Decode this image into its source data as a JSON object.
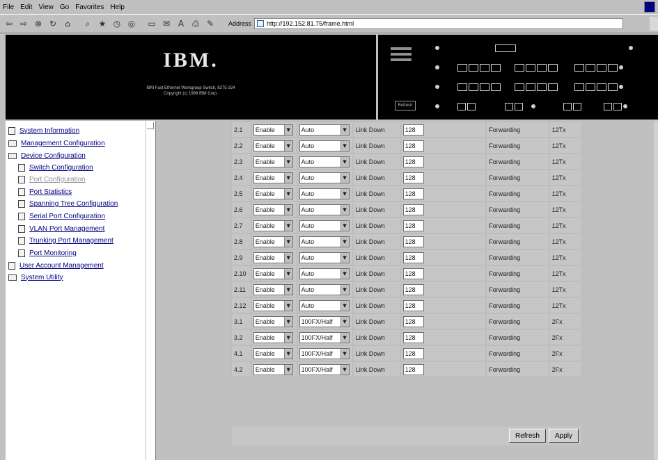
{
  "browser": {
    "menu": [
      "File",
      "Edit",
      "View",
      "Go",
      "Favorites",
      "Help"
    ],
    "address_label": "Address",
    "address_url": "http://192.152.81.75/frame.html"
  },
  "banner": {
    "logo": "IBM.",
    "line1": "IBM Fast Ethernet Workgroup Switch, 8275-324",
    "line2": "Copyright (c) 1998 IBM Corp.",
    "panel_refresh": "Refresh"
  },
  "tree": {
    "items": [
      {
        "label": "System Information",
        "icon": "page-icon"
      },
      {
        "label": "Management Configuration",
        "icon": "folder-icon"
      },
      {
        "label": "Device Configuration",
        "icon": "open-folder-icon"
      },
      {
        "label": "Switch Configuration",
        "icon": "page-icon"
      },
      {
        "label": "Port Configuration",
        "icon": "page-icon"
      },
      {
        "label": "Port Statistics",
        "icon": "page-icon"
      },
      {
        "label": "Spanning Tree Configuration",
        "icon": "page-icon"
      },
      {
        "label": "Serial Port Configuration",
        "icon": "page-icon"
      },
      {
        "label": "VLAN Port Management",
        "icon": "page-icon"
      },
      {
        "label": "Trunking Port Management",
        "icon": "page-icon"
      },
      {
        "label": "Port Monitoring",
        "icon": "page-icon"
      },
      {
        "label": "User Account Management",
        "icon": "page-icon"
      },
      {
        "label": "System Utility",
        "icon": "folder-icon"
      }
    ]
  },
  "ports": [
    {
      "port": "2.1",
      "enable": "Enable",
      "speed": "Auto",
      "link": "Link Down",
      "priority": "128",
      "state": "Forwarding",
      "type": "12Tx"
    },
    {
      "port": "2.2",
      "enable": "Enable",
      "speed": "Auto",
      "link": "Link Down",
      "priority": "128",
      "state": "Forwarding",
      "type": "12Tx"
    },
    {
      "port": "2.3",
      "enable": "Enable",
      "speed": "Auto",
      "link": "Link Down",
      "priority": "128",
      "state": "Forwarding",
      "type": "12Tx"
    },
    {
      "port": "2.4",
      "enable": "Enable",
      "speed": "Auto",
      "link": "Link Down",
      "priority": "128",
      "state": "Forwarding",
      "type": "12Tx"
    },
    {
      "port": "2.5",
      "enable": "Enable",
      "speed": "Auto",
      "link": "Link Down",
      "priority": "128",
      "state": "Forwarding",
      "type": "12Tx"
    },
    {
      "port": "2.6",
      "enable": "Enable",
      "speed": "Auto",
      "link": "Link Down",
      "priority": "128",
      "state": "Forwarding",
      "type": "12Tx"
    },
    {
      "port": "2.7",
      "enable": "Enable",
      "speed": "Auto",
      "link": "Link Down",
      "priority": "128",
      "state": "Forwarding",
      "type": "12Tx"
    },
    {
      "port": "2.8",
      "enable": "Enable",
      "speed": "Auto",
      "link": "Link Down",
      "priority": "128",
      "state": "Forwarding",
      "type": "12Tx"
    },
    {
      "port": "2.9",
      "enable": "Enable",
      "speed": "Auto",
      "link": "Link Down",
      "priority": "128",
      "state": "Forwarding",
      "type": "12Tx"
    },
    {
      "port": "2.10",
      "enable": "Enable",
      "speed": "Auto",
      "link": "Link Down",
      "priority": "128",
      "state": "Forwarding",
      "type": "12Tx"
    },
    {
      "port": "2.11",
      "enable": "Enable",
      "speed": "Auto",
      "link": "Link Down",
      "priority": "128",
      "state": "Forwarding",
      "type": "12Tx"
    },
    {
      "port": "2.12",
      "enable": "Enable",
      "speed": "Auto",
      "link": "Link Down",
      "priority": "128",
      "state": "Forwarding",
      "type": "12Tx"
    },
    {
      "port": "3.1",
      "enable": "Enable",
      "speed": "100FX/Half",
      "link": "Link Down",
      "priority": "128",
      "state": "Forwarding",
      "type": "2Fx"
    },
    {
      "port": "3.2",
      "enable": "Enable",
      "speed": "100FX/Half",
      "link": "Link Down",
      "priority": "128",
      "state": "Forwarding",
      "type": "2Fx"
    },
    {
      "port": "4.1",
      "enable": "Enable",
      "speed": "100FX/Half",
      "link": "Link Down",
      "priority": "128",
      "state": "Forwarding",
      "type": "2Fx"
    },
    {
      "port": "4.2",
      "enable": "Enable",
      "speed": "100FX/Half",
      "link": "Link Down",
      "priority": "128",
      "state": "Forwarding",
      "type": "2Fx"
    }
  ],
  "buttons": {
    "refresh": "Refresh",
    "apply": "Apply"
  }
}
